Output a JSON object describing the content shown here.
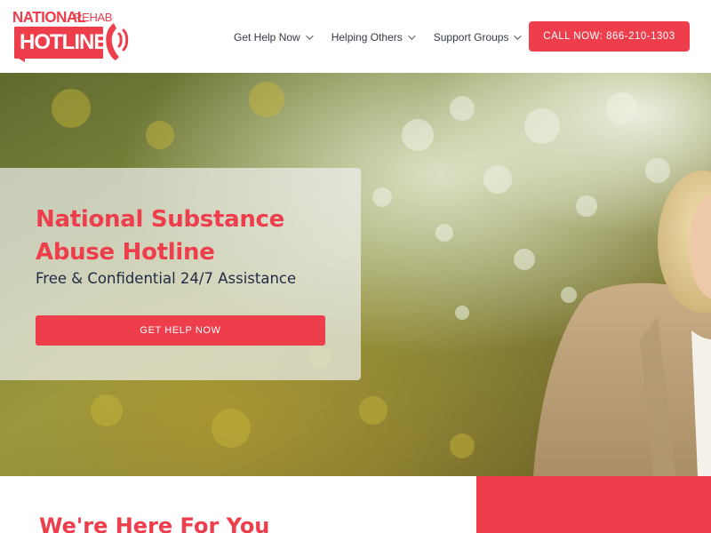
{
  "logo": {
    "line1": "NATIONAL",
    "line1_small": "REHAB",
    "line2": "HOTLINE",
    "icon": "phone-handset-icon"
  },
  "nav": {
    "items": [
      {
        "label": "Get Help Now",
        "icon": "chevron-down-icon"
      },
      {
        "label": "Helping Others",
        "icon": "chevron-down-icon"
      },
      {
        "label": "Support Groups",
        "icon": "chevron-down-icon"
      }
    ],
    "call_button": "CALL NOW: 866-210-1303"
  },
  "hero": {
    "title": "National Substance Abuse Hotline",
    "subtitle": "Free & Confidential 24/7 Assistance",
    "cta": "GET HELP NOW"
  },
  "section": {
    "heading": "We're Here For You"
  },
  "colors": {
    "brand_red": "#ee3e4b",
    "navy_text": "#1f2a44",
    "nav_text": "#333a44"
  }
}
